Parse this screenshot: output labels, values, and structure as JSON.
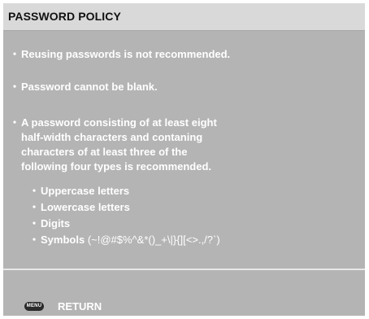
{
  "dialog": {
    "title": "PASSWORD POLICY",
    "bullet_glyph": "・",
    "rules": [
      {
        "text": "Reusing passwords is not recommended."
      },
      {
        "text": "Password cannot be blank."
      },
      {
        "lines": [
          "A password consisting of at least eight",
          "half-width characters and contaning",
          "characters of at least three of the",
          "following four types is recommended."
        ]
      }
    ],
    "char_types": [
      {
        "label": "Uppercase letters"
      },
      {
        "label": "Lowercase letters"
      },
      {
        "label": "Digits"
      },
      {
        "label": "Symbols",
        "detail": "(~!@#$%^&*()_+\\|}{][<>.,/?`)"
      }
    ]
  },
  "footer": {
    "key_label": "MENU",
    "action_label": "RETURN"
  },
  "colors": {
    "panel_background": "#b4b4b4",
    "title_bar_background": "#d9d9d9",
    "title_text": "#111111",
    "body_text": "#ffffff",
    "menu_key_background": "#2b2b2b"
  }
}
